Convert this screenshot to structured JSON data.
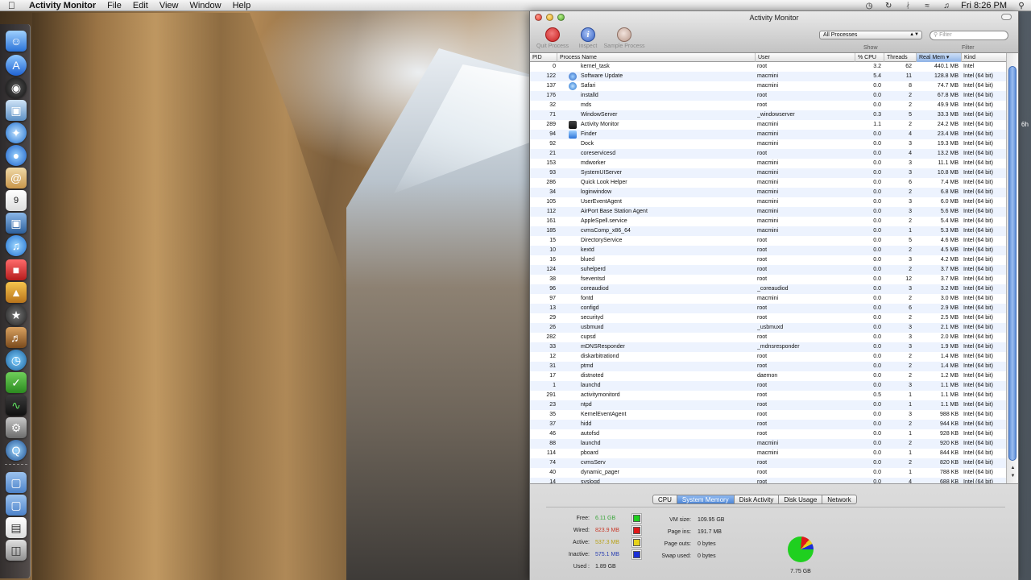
{
  "menubar": {
    "app_name": "Activity Monitor",
    "items": [
      "File",
      "Edit",
      "View",
      "Window",
      "Help"
    ],
    "clock": "Fri 8:26 PM"
  },
  "window": {
    "title": "Activity Monitor",
    "toolbar": {
      "quit_label": "Quit Process",
      "inspect_label": "Inspect",
      "sample_label": "Sample Process",
      "show_value": "All Processes",
      "show_label": "Show",
      "filter_placeholder": "Filter",
      "filter_label": "Filter"
    },
    "columns": {
      "pid": "PID",
      "name": "Process Name",
      "user": "User",
      "cpu": "% CPU",
      "threads": "Threads",
      "mem": "Real Mem",
      "kind": "Kind"
    },
    "processes": [
      {
        "pid": "0",
        "icon": "",
        "name": "kernel_task",
        "user": "root",
        "cpu": "3.2",
        "threads": "62",
        "mem": "440.1 MB",
        "kind": "Intel"
      },
      {
        "pid": "122",
        "icon": "software-update",
        "name": "Software Update",
        "user": "macmini",
        "cpu": "5.4",
        "threads": "11",
        "mem": "128.8 MB",
        "kind": "Intel (64 bit)"
      },
      {
        "pid": "137",
        "icon": "safari",
        "name": "Safari",
        "user": "macmini",
        "cpu": "0.0",
        "threads": "8",
        "mem": "74.7 MB",
        "kind": "Intel (64 bit)"
      },
      {
        "pid": "176",
        "icon": "",
        "name": "installd",
        "user": "root",
        "cpu": "0.0",
        "threads": "2",
        "mem": "67.8 MB",
        "kind": "Intel (64 bit)"
      },
      {
        "pid": "32",
        "icon": "",
        "name": "mds",
        "user": "root",
        "cpu": "0.0",
        "threads": "2",
        "mem": "49.9 MB",
        "kind": "Intel (64 bit)"
      },
      {
        "pid": "71",
        "icon": "",
        "name": "WindowServer",
        "user": "_windowserver",
        "cpu": "0.3",
        "threads": "5",
        "mem": "33.3 MB",
        "kind": "Intel (64 bit)"
      },
      {
        "pid": "289",
        "icon": "activity-monitor",
        "name": "Activity Monitor",
        "user": "macmini",
        "cpu": "1.1",
        "threads": "2",
        "mem": "24.2 MB",
        "kind": "Intel (64 bit)"
      },
      {
        "pid": "94",
        "icon": "finder",
        "name": "Finder",
        "user": "macmini",
        "cpu": "0.0",
        "threads": "4",
        "mem": "23.4 MB",
        "kind": "Intel (64 bit)"
      },
      {
        "pid": "92",
        "icon": "",
        "name": "Dock",
        "user": "macmini",
        "cpu": "0.0",
        "threads": "3",
        "mem": "19.3 MB",
        "kind": "Intel (64 bit)"
      },
      {
        "pid": "21",
        "icon": "",
        "name": "coreservicesd",
        "user": "root",
        "cpu": "0.0",
        "threads": "4",
        "mem": "13.2 MB",
        "kind": "Intel (64 bit)"
      },
      {
        "pid": "153",
        "icon": "",
        "name": "mdworker",
        "user": "macmini",
        "cpu": "0.0",
        "threads": "3",
        "mem": "11.1 MB",
        "kind": "Intel (64 bit)"
      },
      {
        "pid": "93",
        "icon": "",
        "name": "SystemUIServer",
        "user": "macmini",
        "cpu": "0.0",
        "threads": "3",
        "mem": "10.8 MB",
        "kind": "Intel (64 bit)"
      },
      {
        "pid": "286",
        "icon": "",
        "name": "Quick Look Helper",
        "user": "macmini",
        "cpu": "0.0",
        "threads": "6",
        "mem": "7.4 MB",
        "kind": "Intel (64 bit)"
      },
      {
        "pid": "34",
        "icon": "",
        "name": "loginwindow",
        "user": "macmini",
        "cpu": "0.0",
        "threads": "2",
        "mem": "6.8 MB",
        "kind": "Intel (64 bit)"
      },
      {
        "pid": "105",
        "icon": "",
        "name": "UserEventAgent",
        "user": "macmini",
        "cpu": "0.0",
        "threads": "3",
        "mem": "6.0 MB",
        "kind": "Intel (64 bit)"
      },
      {
        "pid": "112",
        "icon": "",
        "name": "AirPort Base Station Agent",
        "user": "macmini",
        "cpu": "0.0",
        "threads": "3",
        "mem": "5.6 MB",
        "kind": "Intel (64 bit)"
      },
      {
        "pid": "161",
        "icon": "",
        "name": "AppleSpell.service",
        "user": "macmini",
        "cpu": "0.0",
        "threads": "2",
        "mem": "5.4 MB",
        "kind": "Intel (64 bit)"
      },
      {
        "pid": "185",
        "icon": "",
        "name": "cvmsComp_x86_64",
        "user": "macmini",
        "cpu": "0.0",
        "threads": "1",
        "mem": "5.3 MB",
        "kind": "Intel (64 bit)"
      },
      {
        "pid": "15",
        "icon": "",
        "name": "DirectoryService",
        "user": "root",
        "cpu": "0.0",
        "threads": "5",
        "mem": "4.6 MB",
        "kind": "Intel (64 bit)"
      },
      {
        "pid": "10",
        "icon": "",
        "name": "kextd",
        "user": "root",
        "cpu": "0.0",
        "threads": "2",
        "mem": "4.5 MB",
        "kind": "Intel (64 bit)"
      },
      {
        "pid": "16",
        "icon": "",
        "name": "blued",
        "user": "root",
        "cpu": "0.0",
        "threads": "3",
        "mem": "4.2 MB",
        "kind": "Intel (64 bit)"
      },
      {
        "pid": "124",
        "icon": "",
        "name": "suhelperd",
        "user": "root",
        "cpu": "0.0",
        "threads": "2",
        "mem": "3.7 MB",
        "kind": "Intel (64 bit)"
      },
      {
        "pid": "38",
        "icon": "",
        "name": "fseventsd",
        "user": "root",
        "cpu": "0.0",
        "threads": "12",
        "mem": "3.7 MB",
        "kind": "Intel (64 bit)"
      },
      {
        "pid": "96",
        "icon": "",
        "name": "coreaudiod",
        "user": "_coreaudiod",
        "cpu": "0.0",
        "threads": "3",
        "mem": "3.2 MB",
        "kind": "Intel (64 bit)"
      },
      {
        "pid": "97",
        "icon": "",
        "name": "fontd",
        "user": "macmini",
        "cpu": "0.0",
        "threads": "2",
        "mem": "3.0 MB",
        "kind": "Intel (64 bit)"
      },
      {
        "pid": "13",
        "icon": "",
        "name": "configd",
        "user": "root",
        "cpu": "0.0",
        "threads": "6",
        "mem": "2.9 MB",
        "kind": "Intel (64 bit)"
      },
      {
        "pid": "29",
        "icon": "",
        "name": "securityd",
        "user": "root",
        "cpu": "0.0",
        "threads": "2",
        "mem": "2.5 MB",
        "kind": "Intel (64 bit)"
      },
      {
        "pid": "26",
        "icon": "",
        "name": "usbmuxd",
        "user": "_usbmuxd",
        "cpu": "0.0",
        "threads": "3",
        "mem": "2.1 MB",
        "kind": "Intel (64 bit)"
      },
      {
        "pid": "282",
        "icon": "",
        "name": "cupsd",
        "user": "root",
        "cpu": "0.0",
        "threads": "3",
        "mem": "2.0 MB",
        "kind": "Intel (64 bit)"
      },
      {
        "pid": "33",
        "icon": "",
        "name": "mDNSResponder",
        "user": "_mdnsresponder",
        "cpu": "0.0",
        "threads": "3",
        "mem": "1.9 MB",
        "kind": "Intel (64 bit)"
      },
      {
        "pid": "12",
        "icon": "",
        "name": "diskarbitrationd",
        "user": "root",
        "cpu": "0.0",
        "threads": "2",
        "mem": "1.4 MB",
        "kind": "Intel (64 bit)"
      },
      {
        "pid": "31",
        "icon": "",
        "name": "ptmd",
        "user": "root",
        "cpu": "0.0",
        "threads": "2",
        "mem": "1.4 MB",
        "kind": "Intel (64 bit)"
      },
      {
        "pid": "17",
        "icon": "",
        "name": "distnoted",
        "user": "daemon",
        "cpu": "0.0",
        "threads": "2",
        "mem": "1.2 MB",
        "kind": "Intel (64 bit)"
      },
      {
        "pid": "1",
        "icon": "",
        "name": "launchd",
        "user": "root",
        "cpu": "0.0",
        "threads": "3",
        "mem": "1.1 MB",
        "kind": "Intel (64 bit)"
      },
      {
        "pid": "291",
        "icon": "",
        "name": "activitymonitord",
        "user": "root",
        "cpu": "0.5",
        "threads": "1",
        "mem": "1.1 MB",
        "kind": "Intel (64 bit)"
      },
      {
        "pid": "23",
        "icon": "",
        "name": "ntpd",
        "user": "root",
        "cpu": "0.0",
        "threads": "1",
        "mem": "1.1 MB",
        "kind": "Intel (64 bit)"
      },
      {
        "pid": "35",
        "icon": "",
        "name": "KernelEventAgent",
        "user": "root",
        "cpu": "0.0",
        "threads": "3",
        "mem": "988 KB",
        "kind": "Intel (64 bit)"
      },
      {
        "pid": "37",
        "icon": "",
        "name": "hidd",
        "user": "root",
        "cpu": "0.0",
        "threads": "2",
        "mem": "944 KB",
        "kind": "Intel (64 bit)"
      },
      {
        "pid": "46",
        "icon": "",
        "name": "autofsd",
        "user": "root",
        "cpu": "0.0",
        "threads": "1",
        "mem": "928 KB",
        "kind": "Intel (64 bit)"
      },
      {
        "pid": "88",
        "icon": "",
        "name": "launchd",
        "user": "macmini",
        "cpu": "0.0",
        "threads": "2",
        "mem": "920 KB",
        "kind": "Intel (64 bit)"
      },
      {
        "pid": "114",
        "icon": "",
        "name": "pboard",
        "user": "macmini",
        "cpu": "0.0",
        "threads": "1",
        "mem": "844 KB",
        "kind": "Intel (64 bit)"
      },
      {
        "pid": "74",
        "icon": "",
        "name": "cvmsServ",
        "user": "root",
        "cpu": "0.0",
        "threads": "2",
        "mem": "820 KB",
        "kind": "Intel (64 bit)"
      },
      {
        "pid": "40",
        "icon": "",
        "name": "dynamic_pager",
        "user": "root",
        "cpu": "0.0",
        "threads": "1",
        "mem": "788 KB",
        "kind": "Intel (64 bit)"
      },
      {
        "pid": "14",
        "icon": "",
        "name": "syslogd",
        "user": "root",
        "cpu": "0.0",
        "threads": "4",
        "mem": "688 KB",
        "kind": "Intel (64 bit)"
      }
    ],
    "tabs": [
      "CPU",
      "System Memory",
      "Disk Activity",
      "Disk Usage",
      "Network"
    ],
    "active_tab": "System Memory",
    "memory": {
      "free_label": "Free:",
      "free_value": "6.11 GB",
      "wired_label": "Wired:",
      "wired_value": "823.9 MB",
      "active_label": "Active:",
      "active_value": "537.3 MB",
      "inactive_label": "Inactive:",
      "inactive_value": "575.1 MB",
      "used_label": "Used :",
      "used_value": "1.89 GB",
      "vm_size_label": "VM size:",
      "vm_size_value": "109.95 GB",
      "page_ins_label": "Page ins:",
      "page_ins_value": "191.7 MB",
      "page_outs_label": "Page outs:",
      "page_outs_value": "0 bytes",
      "swap_used_label": "Swap used:",
      "swap_used_value": "0 bytes",
      "total": "7.75 GB",
      "colors": {
        "free": "#1fd01f",
        "wired": "#e01818",
        "active": "#e6d21a",
        "inactive": "#1a2fd6"
      },
      "value_colors": {
        "free": "#3aa63a",
        "wired": "#c83a2a",
        "active": "#b8a21a",
        "inactive": "#2a3fb0"
      }
    }
  },
  "dock_icons": [
    "finder-icon",
    "app-store-icon",
    "dashboard-icon",
    "preview-icon",
    "safari-icon",
    "ichat-icon",
    "mail-icon",
    "ical-icon",
    "iphoto-icon",
    "itunes-icon",
    "photo-booth-icon",
    "iphoto-frame-icon",
    "imovie-icon",
    "garageband-icon",
    "time-machine-icon",
    "update-icon",
    "activity-monitor-icon",
    "system-preferences-icon",
    "quicktime-icon"
  ]
}
